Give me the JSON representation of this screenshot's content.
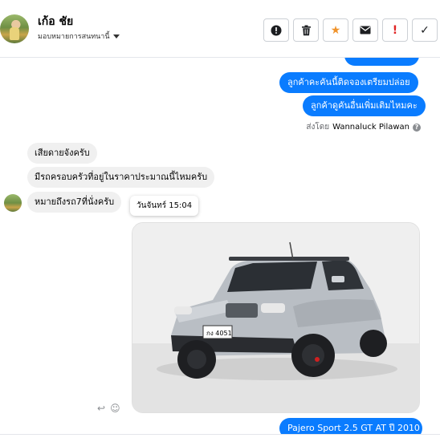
{
  "header": {
    "contact_name": "เก้อ ชัย",
    "assign_label": "มอบหมายการสนทนานี้"
  },
  "actions": [
    {
      "name": "report-button",
      "icon": "exclamation-circle-icon",
      "glyph": "!"
    },
    {
      "name": "trash-button",
      "icon": "trash-icon"
    },
    {
      "name": "star-button",
      "icon": "star-icon",
      "glyph": "★",
      "color": "#f0932b"
    },
    {
      "name": "email-button",
      "icon": "envelope-icon"
    },
    {
      "name": "follow-up-button",
      "icon": "exclamation-icon",
      "glyph": "!",
      "color": "#e02424"
    },
    {
      "name": "done-button",
      "icon": "checkmark-icon",
      "glyph": "✓"
    }
  ],
  "messages": {
    "outgoing": [
      {
        "text": "ลูกค้าคะคันนี้ติดจองเตรียมปล่อย"
      },
      {
        "text": "ลูกค้าดูคันอื่นเพิ่มเติมไหมคะ"
      },
      {
        "text": "Pajero Sport 2.5 GT AT ปี 2010"
      }
    ],
    "sent_by_label": "ส่งโดย",
    "sent_by_name": "Wannaluck Pilawan",
    "incoming": [
      {
        "text": "เสียดายจังครับ"
      },
      {
        "text": "มีรถครอบครัวที่อยู่ในราคาประมาณนี้ไหมครับ"
      },
      {
        "text": "หมายถึงรถ7ที่นั่งครับ"
      }
    ],
    "timestamp_tooltip": "วันจันทร์ 15:04"
  },
  "colors": {
    "outgoing_bubble": "#0a7cff",
    "incoming_bubble": "#f0f0f0",
    "accent_star": "#f0932b",
    "alert_red": "#e02424"
  }
}
